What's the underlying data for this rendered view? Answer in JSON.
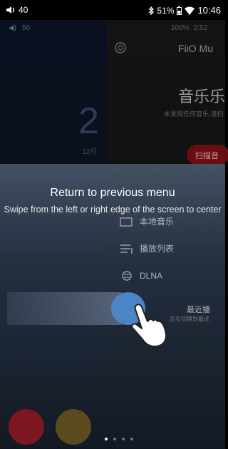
{
  "status_bar": {
    "volume": "40",
    "battery": "51%",
    "time": "10:46"
  },
  "background_app": {
    "inner_volume": "50",
    "inner_battery": "100%",
    "inner_time": "2:52",
    "brand": "FiiO Mu",
    "clock_digit": "2",
    "month": "12月",
    "music_title": "音乐乐",
    "music_subtitle": "未发现任何音乐,请扫",
    "scan_button": "扫描音",
    "menu": [
      {
        "label": "本地音乐",
        "icon": "music-folder-icon"
      },
      {
        "label": "播放列表",
        "icon": "playlist-icon"
      },
      {
        "label": "DLNA",
        "icon": "dlna-icon"
      }
    ],
    "recent_title": "最近播",
    "recent_subtitle": "左右切换到最近"
  },
  "overlay": {
    "title": "Return to previous menu",
    "subtitle": "Swipe from the left or right edge of the screen to center"
  },
  "colors": {
    "swipe_dot": "#4a85c6",
    "overlay": "#3f4f63"
  },
  "page_indicator": {
    "total": 4,
    "active": 1
  }
}
